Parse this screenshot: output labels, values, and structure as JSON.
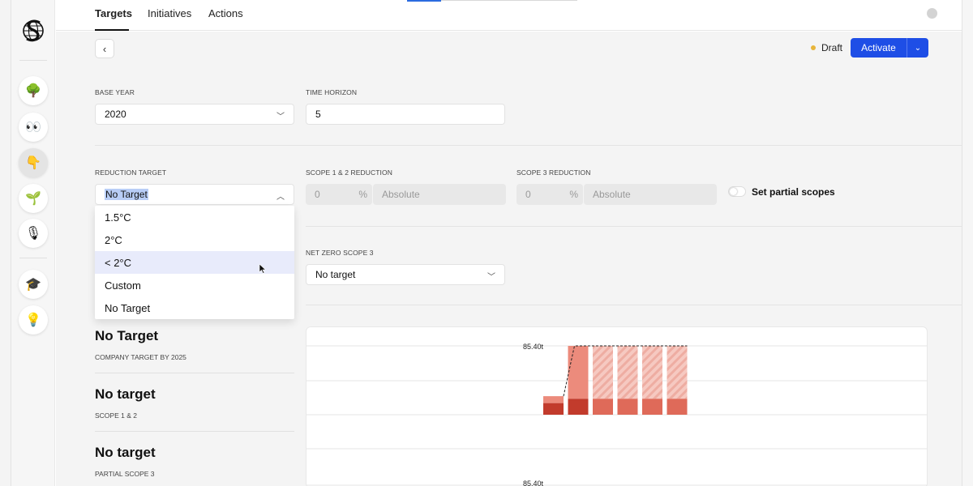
{
  "nav": {
    "tabs": [
      {
        "label": "Targets"
      },
      {
        "label": "Initiatives"
      },
      {
        "label": "Actions"
      }
    ],
    "rail_icons": [
      "tree-icon",
      "eyes-icon",
      "hand-icon",
      "sprout-icon",
      "microphone-icon",
      "graduation-cap-icon",
      "lightbulb-icon"
    ]
  },
  "header": {
    "status": "Draft",
    "activate_label": "Activate"
  },
  "form": {
    "base_year": {
      "label": "BASE YEAR",
      "value": "2020"
    },
    "time_horizon": {
      "label": "TIME HORIZON",
      "value": "5"
    },
    "reduction_target": {
      "label": "REDUCTION TARGET",
      "value": "No Target"
    },
    "scope12": {
      "label": "SCOPE 1 & 2 REDUCTION",
      "value": "0",
      "unit": "%",
      "placeholder": "Absolute"
    },
    "scope3": {
      "label": "SCOPE 3 REDUCTION",
      "value": "0",
      "unit": "%",
      "placeholder": "Absolute"
    },
    "partial_scopes_label": "Set partial scopes",
    "partial_scopes_on": false,
    "net_zero_scope3": {
      "label": "NET ZERO SCOPE 3",
      "value": "No target"
    }
  },
  "dropdown": {
    "options": [
      "1.5°C",
      "2°C",
      "< 2°C",
      "Custom",
      "No Target"
    ],
    "highlighted": "< 2°C"
  },
  "summary": [
    {
      "title": "No Target",
      "subtitle": "COMPANY TARGET BY 2025"
    },
    {
      "title": "No target",
      "subtitle": "SCOPE 1 & 2"
    },
    {
      "title": "No target",
      "subtitle": "PARTIAL SCOPE 3"
    }
  ],
  "colors": {
    "accent": "#1e4ee6",
    "draft_dot": "#e7b53a",
    "bar_light": "#ec8b7c",
    "bar_dark": "#c23b2c",
    "bar_mid": "#df6a59"
  },
  "chart_data": [
    {
      "type": "bar",
      "categories": [
        "",
        "",
        "",
        "",
        "",
        ""
      ],
      "series": [
        {
          "values": [
            2.4,
            3.3,
            3.3,
            3.3,
            3.3,
            3.3
          ]
        },
        {
          "values": [
            20.6,
            82.1,
            82.1,
            82.1,
            82.1,
            82.1
          ]
        }
      ],
      "stacked": true,
      "forecast_hatched_from_index": 2,
      "annotations": [
        "85.40t"
      ],
      "ylim": [
        0,
        85.4
      ],
      "grid": true
    },
    {
      "type": "bar",
      "categories": [],
      "series": [],
      "annotations": [
        "85.40t"
      ],
      "grid": true
    }
  ]
}
